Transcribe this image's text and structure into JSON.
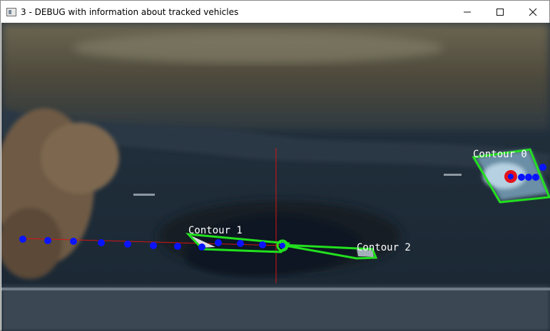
{
  "window": {
    "title": "3 - DEBUG with information about tracked vehicles",
    "minimize_icon": "minimize-icon",
    "maximize_icon": "maximize-icon",
    "close_icon": "close-icon"
  },
  "overlay": {
    "contours": [
      {
        "label": "Contour 0"
      },
      {
        "label": "Contour 1"
      },
      {
        "label": "Contour 2"
      }
    ],
    "colors": {
      "contour": "#22e01e",
      "track_point": "#0a14ff",
      "centroid_marker": "#e4141c",
      "crosshair": "#d41414"
    }
  }
}
